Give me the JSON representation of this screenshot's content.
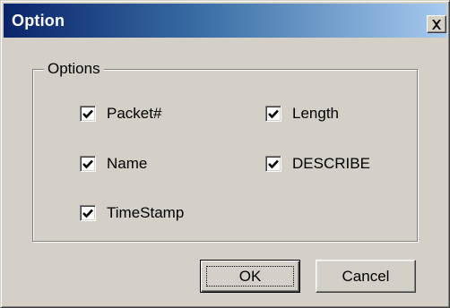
{
  "window": {
    "title": "Option",
    "close_glyph": "✕"
  },
  "options_group": {
    "legend": "Options",
    "items": [
      {
        "label": "Packet#",
        "checked": true
      },
      {
        "label": "Length",
        "checked": true
      },
      {
        "label": "Name",
        "checked": true
      },
      {
        "label": "DESCRIBE",
        "checked": true
      },
      {
        "label": "TimeStamp",
        "checked": true
      }
    ]
  },
  "buttons": {
    "ok_label": "OK",
    "cancel_label": "Cancel"
  },
  "icons": {
    "close": "close-icon",
    "check": "checkmark-icon"
  },
  "colors": {
    "title_gradient_start": "#0a246a",
    "title_gradient_end": "#a6caf0",
    "face": "#d4d0c8"
  }
}
